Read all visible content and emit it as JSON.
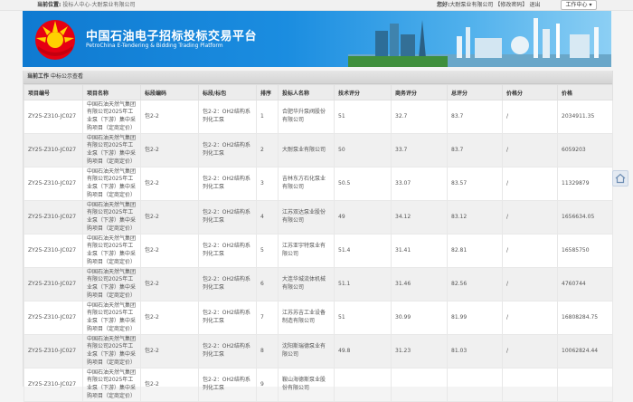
{
  "topbar": {
    "location_label": "当前位置:",
    "location_path": "投标人中心-大耐泵业有限公司",
    "greeting_label": "您好:",
    "user_name": "大耐泵业有限公司",
    "modify_pwd": "【修改密码】",
    "logout": "退出",
    "workspace_label": "工作中心"
  },
  "banner": {
    "title_cn": "中国石油电子招标投标交易平台",
    "title_en": "PetroChina E-Tendering & Bidding Trading Platform"
  },
  "crumb": {
    "label": "当前工作",
    "current": "中标公示查看"
  },
  "table": {
    "headers": [
      "项目编号",
      "项目名称",
      "标段编码",
      "标段/标包",
      "排序",
      "投标人名称",
      "技术评分",
      "商务评分",
      "总评分",
      "价格分",
      "价格"
    ],
    "rows": [
      [
        "ZY25-Z310-JC027",
        "中国石油天然气集团有限公司2025年工业泵（下游）集中采购项目（定商定价）",
        "包2-2",
        "包2-2：OH2结构系列化工泵",
        "1",
        "合肥华升泵阀股份有限公司",
        "51",
        "32.7",
        "83.7",
        "/",
        "2034911.35"
      ],
      [
        "ZY25-Z310-JC027",
        "中国石油天然气集团有限公司2025年工业泵（下游）集中采购项目（定商定价）",
        "包2-2",
        "包2-2：OH2结构系列化工泵",
        "2",
        "大耐泵业有限公司",
        "50",
        "33.7",
        "83.7",
        "/",
        "6059203"
      ],
      [
        "ZY25-Z310-JC027",
        "中国石油天然气集团有限公司2025年工业泵（下游）集中采购项目（定商定价）",
        "包2-2",
        "包2-2：OH2结构系列化工泵",
        "3",
        "吉林东方石化泵业有限公司",
        "50.5",
        "33.07",
        "83.57",
        "/",
        "11329879"
      ],
      [
        "ZY25-Z310-JC027",
        "中国石油天然气集团有限公司2025年工业泵（下游）集中采购项目（定商定价）",
        "包2-2",
        "包2-2：OH2结构系列化工泵",
        "4",
        "江苏双达泵业股份有限公司",
        "49",
        "34.12",
        "83.12",
        "/",
        "1656634.05"
      ],
      [
        "ZY25-Z310-JC027",
        "中国石油天然气集团有限公司2025年工业泵（下游）集中采购项目（定商定价）",
        "包2-2",
        "包2-2：OH2结构系列化工泵",
        "5",
        "江苏亚宇特泵业有限公司",
        "51.4",
        "31.41",
        "82.81",
        "/",
        "16585750"
      ],
      [
        "ZY25-Z310-JC027",
        "中国石油天然气集团有限公司2025年工业泵（下游）集中采购项目（定商定价）",
        "包2-2",
        "包2-2：OH2结构系列化工泵",
        "6",
        "大连华城流体机械有限公司",
        "51.1",
        "31.46",
        "82.56",
        "/",
        "4760744"
      ],
      [
        "ZY25-Z310-JC027",
        "中国石油天然气集团有限公司2025年工业泵（下游）集中采购项目（定商定价）",
        "包2-2",
        "包2-2：OH2结构系列化工泵",
        "7",
        "江苏苏吉工业设备制造有限公司",
        "51",
        "30.99",
        "81.99",
        "/",
        "16808284.75"
      ],
      [
        "ZY25-Z310-JC027",
        "中国石油天然气集团有限公司2025年工业泵（下游）集中采购项目（定商定价）",
        "包2-2",
        "包2-2：OH2结构系列化工泵",
        "8",
        "沈阳斯瑞德泵业有限公司",
        "49.8",
        "31.23",
        "81.03",
        "/",
        "10062824.44"
      ],
      [
        "ZY25-Z310-JC027",
        "中国石油天然气集团有限公司2025年工业泵（下游）集中采购项目（定商定价）",
        "包2-2",
        "包2-2：OH2结构系列化工泵",
        "9",
        "鞍山海德斯泵业股份有限公司",
        "",
        "",
        "",
        "",
        ""
      ]
    ]
  },
  "colors": {
    "banner_blue": "#1b8de0",
    "header_gray": "#ececec"
  }
}
